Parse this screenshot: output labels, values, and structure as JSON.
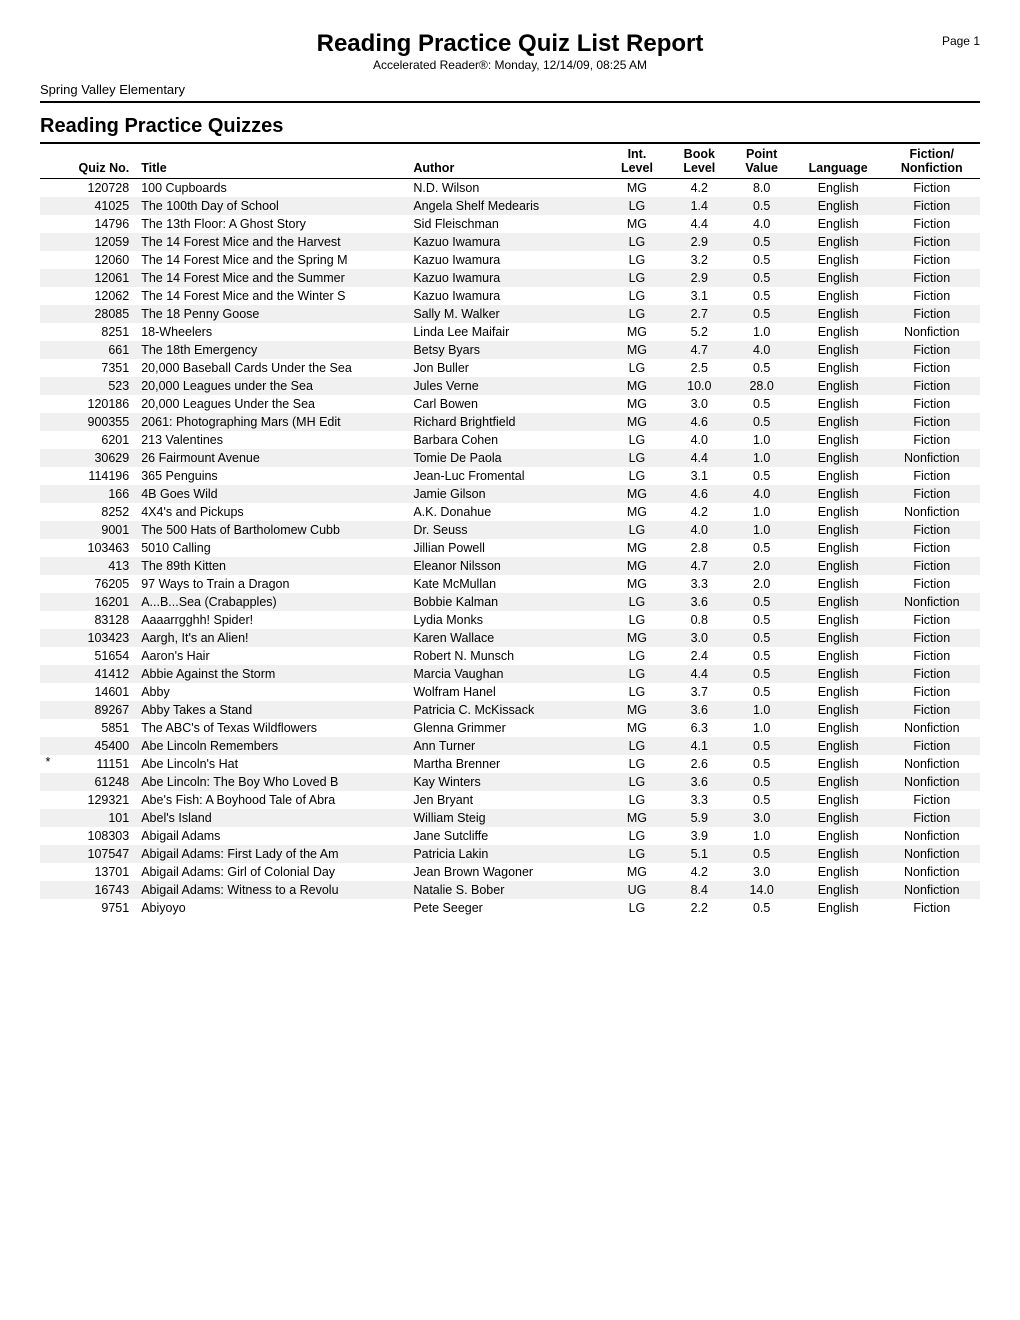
{
  "header": {
    "title": "Reading Practice Quiz List Report",
    "page_label": "Page 1",
    "subtitle": "Accelerated Reader®:  Monday, 12/14/09, 08:25 AM",
    "school": "Spring Valley Elementary"
  },
  "section_title": "Reading Practice Quizzes",
  "columns": {
    "quiz_no": "Quiz No.",
    "title": "Title",
    "author": "Author",
    "int_level": "Int.\nLevel",
    "book_level": "Book\nLevel",
    "point_value": "Point\nValue",
    "language": "Language",
    "fiction_nonfiction": "Fiction/\nNonfiction"
  },
  "rows": [
    {
      "star": "",
      "quiz_no": "120728",
      "title": "100 Cupboards",
      "author": "N.D. Wilson",
      "int_level": "MG",
      "book_level": "4.2",
      "point_value": "8.0",
      "language": "English",
      "fiction": "Fiction"
    },
    {
      "star": "",
      "quiz_no": "41025",
      "title": "The 100th Day of School",
      "author": "Angela Shelf Medearis",
      "int_level": "LG",
      "book_level": "1.4",
      "point_value": "0.5",
      "language": "English",
      "fiction": "Fiction"
    },
    {
      "star": "",
      "quiz_no": "14796",
      "title": "The 13th Floor: A Ghost Story",
      "author": "Sid Fleischman",
      "int_level": "MG",
      "book_level": "4.4",
      "point_value": "4.0",
      "language": "English",
      "fiction": "Fiction"
    },
    {
      "star": "",
      "quiz_no": "12059",
      "title": "The 14 Forest Mice and the Harvest",
      "author": "Kazuo Iwamura",
      "int_level": "LG",
      "book_level": "2.9",
      "point_value": "0.5",
      "language": "English",
      "fiction": "Fiction"
    },
    {
      "star": "",
      "quiz_no": "12060",
      "title": "The 14 Forest Mice and the Spring M",
      "author": "Kazuo Iwamura",
      "int_level": "LG",
      "book_level": "3.2",
      "point_value": "0.5",
      "language": "English",
      "fiction": "Fiction"
    },
    {
      "star": "",
      "quiz_no": "12061",
      "title": "The 14 Forest Mice and the Summer",
      "author": "Kazuo Iwamura",
      "int_level": "LG",
      "book_level": "2.9",
      "point_value": "0.5",
      "language": "English",
      "fiction": "Fiction"
    },
    {
      "star": "",
      "quiz_no": "12062",
      "title": "The 14 Forest Mice and the Winter S",
      "author": "Kazuo Iwamura",
      "int_level": "LG",
      "book_level": "3.1",
      "point_value": "0.5",
      "language": "English",
      "fiction": "Fiction"
    },
    {
      "star": "",
      "quiz_no": "28085",
      "title": "The 18 Penny Goose",
      "author": "Sally M. Walker",
      "int_level": "LG",
      "book_level": "2.7",
      "point_value": "0.5",
      "language": "English",
      "fiction": "Fiction"
    },
    {
      "star": "",
      "quiz_no": "8251",
      "title": "18-Wheelers",
      "author": "Linda Lee Maifair",
      "int_level": "MG",
      "book_level": "5.2",
      "point_value": "1.0",
      "language": "English",
      "fiction": "Nonfiction"
    },
    {
      "star": "",
      "quiz_no": "661",
      "title": "The 18th Emergency",
      "author": "Betsy Byars",
      "int_level": "MG",
      "book_level": "4.7",
      "point_value": "4.0",
      "language": "English",
      "fiction": "Fiction"
    },
    {
      "star": "",
      "quiz_no": "7351",
      "title": "20,000 Baseball Cards Under the Sea",
      "author": "Jon Buller",
      "int_level": "LG",
      "book_level": "2.5",
      "point_value": "0.5",
      "language": "English",
      "fiction": "Fiction"
    },
    {
      "star": "",
      "quiz_no": "523",
      "title": "20,000 Leagues under the Sea",
      "author": "Jules Verne",
      "int_level": "MG",
      "book_level": "10.0",
      "point_value": "28.0",
      "language": "English",
      "fiction": "Fiction"
    },
    {
      "star": "",
      "quiz_no": "120186",
      "title": "20,000 Leagues Under the Sea",
      "author": "Carl Bowen",
      "int_level": "MG",
      "book_level": "3.0",
      "point_value": "0.5",
      "language": "English",
      "fiction": "Fiction"
    },
    {
      "star": "",
      "quiz_no": "900355",
      "title": "2061: Photographing Mars (MH Edit",
      "author": "Richard Brightfield",
      "int_level": "MG",
      "book_level": "4.6",
      "point_value": "0.5",
      "language": "English",
      "fiction": "Fiction"
    },
    {
      "star": "",
      "quiz_no": "6201",
      "title": "213 Valentines",
      "author": "Barbara Cohen",
      "int_level": "LG",
      "book_level": "4.0",
      "point_value": "1.0",
      "language": "English",
      "fiction": "Fiction"
    },
    {
      "star": "",
      "quiz_no": "30629",
      "title": "26 Fairmount Avenue",
      "author": "Tomie De Paola",
      "int_level": "LG",
      "book_level": "4.4",
      "point_value": "1.0",
      "language": "English",
      "fiction": "Nonfiction"
    },
    {
      "star": "",
      "quiz_no": "114196",
      "title": "365 Penguins",
      "author": "Jean-Luc Fromental",
      "int_level": "LG",
      "book_level": "3.1",
      "point_value": "0.5",
      "language": "English",
      "fiction": "Fiction"
    },
    {
      "star": "",
      "quiz_no": "166",
      "title": "4B Goes Wild",
      "author": "Jamie Gilson",
      "int_level": "MG",
      "book_level": "4.6",
      "point_value": "4.0",
      "language": "English",
      "fiction": "Fiction"
    },
    {
      "star": "",
      "quiz_no": "8252",
      "title": "4X4's and Pickups",
      "author": "A.K. Donahue",
      "int_level": "MG",
      "book_level": "4.2",
      "point_value": "1.0",
      "language": "English",
      "fiction": "Nonfiction"
    },
    {
      "star": "",
      "quiz_no": "9001",
      "title": "The 500 Hats of Bartholomew Cubb",
      "author": "Dr. Seuss",
      "int_level": "LG",
      "book_level": "4.0",
      "point_value": "1.0",
      "language": "English",
      "fiction": "Fiction"
    },
    {
      "star": "",
      "quiz_no": "103463",
      "title": "5010 Calling",
      "author": "Jillian Powell",
      "int_level": "MG",
      "book_level": "2.8",
      "point_value": "0.5",
      "language": "English",
      "fiction": "Fiction"
    },
    {
      "star": "",
      "quiz_no": "413",
      "title": "The 89th Kitten",
      "author": "Eleanor Nilsson",
      "int_level": "MG",
      "book_level": "4.7",
      "point_value": "2.0",
      "language": "English",
      "fiction": "Fiction"
    },
    {
      "star": "",
      "quiz_no": "76205",
      "title": "97 Ways to Train a Dragon",
      "author": "Kate McMullan",
      "int_level": "MG",
      "book_level": "3.3",
      "point_value": "2.0",
      "language": "English",
      "fiction": "Fiction"
    },
    {
      "star": "",
      "quiz_no": "16201",
      "title": "A...B...Sea (Crabapples)",
      "author": "Bobbie Kalman",
      "int_level": "LG",
      "book_level": "3.6",
      "point_value": "0.5",
      "language": "English",
      "fiction": "Nonfiction"
    },
    {
      "star": "",
      "quiz_no": "83128",
      "title": "Aaaarrgghh! Spider!",
      "author": "Lydia Monks",
      "int_level": "LG",
      "book_level": "0.8",
      "point_value": "0.5",
      "language": "English",
      "fiction": "Fiction"
    },
    {
      "star": "",
      "quiz_no": "103423",
      "title": "Aargh, It's an Alien!",
      "author": "Karen Wallace",
      "int_level": "MG",
      "book_level": "3.0",
      "point_value": "0.5",
      "language": "English",
      "fiction": "Fiction"
    },
    {
      "star": "",
      "quiz_no": "51654",
      "title": "Aaron's Hair",
      "author": "Robert N. Munsch",
      "int_level": "LG",
      "book_level": "2.4",
      "point_value": "0.5",
      "language": "English",
      "fiction": "Fiction"
    },
    {
      "star": "",
      "quiz_no": "41412",
      "title": "Abbie Against the Storm",
      "author": "Marcia Vaughan",
      "int_level": "LG",
      "book_level": "4.4",
      "point_value": "0.5",
      "language": "English",
      "fiction": "Fiction"
    },
    {
      "star": "",
      "quiz_no": "14601",
      "title": "Abby",
      "author": "Wolfram Hanel",
      "int_level": "LG",
      "book_level": "3.7",
      "point_value": "0.5",
      "language": "English",
      "fiction": "Fiction"
    },
    {
      "star": "",
      "quiz_no": "89267",
      "title": "Abby Takes a Stand",
      "author": "Patricia C. McKissack",
      "int_level": "MG",
      "book_level": "3.6",
      "point_value": "1.0",
      "language": "English",
      "fiction": "Fiction"
    },
    {
      "star": "",
      "quiz_no": "5851",
      "title": "The ABC's of Texas Wildflowers",
      "author": "Glenna Grimmer",
      "int_level": "MG",
      "book_level": "6.3",
      "point_value": "1.0",
      "language": "English",
      "fiction": "Nonfiction"
    },
    {
      "star": "",
      "quiz_no": "45400",
      "title": "Abe Lincoln Remembers",
      "author": "Ann Turner",
      "int_level": "LG",
      "book_level": "4.1",
      "point_value": "0.5",
      "language": "English",
      "fiction": "Fiction"
    },
    {
      "star": "*",
      "quiz_no": "11151",
      "title": "Abe Lincoln's Hat",
      "author": "Martha Brenner",
      "int_level": "LG",
      "book_level": "2.6",
      "point_value": "0.5",
      "language": "English",
      "fiction": "Nonfiction"
    },
    {
      "star": "",
      "quiz_no": "61248",
      "title": "Abe Lincoln: The Boy Who Loved B",
      "author": "Kay Winters",
      "int_level": "LG",
      "book_level": "3.6",
      "point_value": "0.5",
      "language": "English",
      "fiction": "Nonfiction"
    },
    {
      "star": "",
      "quiz_no": "129321",
      "title": "Abe's Fish: A Boyhood Tale of Abra",
      "author": "Jen Bryant",
      "int_level": "LG",
      "book_level": "3.3",
      "point_value": "0.5",
      "language": "English",
      "fiction": "Fiction"
    },
    {
      "star": "",
      "quiz_no": "101",
      "title": "Abel's Island",
      "author": "William Steig",
      "int_level": "MG",
      "book_level": "5.9",
      "point_value": "3.0",
      "language": "English",
      "fiction": "Fiction"
    },
    {
      "star": "",
      "quiz_no": "108303",
      "title": "Abigail Adams",
      "author": "Jane Sutcliffe",
      "int_level": "LG",
      "book_level": "3.9",
      "point_value": "1.0",
      "language": "English",
      "fiction": "Nonfiction"
    },
    {
      "star": "",
      "quiz_no": "107547",
      "title": "Abigail Adams: First Lady of the Am",
      "author": "Patricia Lakin",
      "int_level": "LG",
      "book_level": "5.1",
      "point_value": "0.5",
      "language": "English",
      "fiction": "Nonfiction"
    },
    {
      "star": "",
      "quiz_no": "13701",
      "title": "Abigail Adams: Girl of Colonial Day",
      "author": "Jean Brown Wagoner",
      "int_level": "MG",
      "book_level": "4.2",
      "point_value": "3.0",
      "language": "English",
      "fiction": "Nonfiction"
    },
    {
      "star": "",
      "quiz_no": "16743",
      "title": "Abigail Adams: Witness to a Revolu",
      "author": "Natalie S. Bober",
      "int_level": "UG",
      "book_level": "8.4",
      "point_value": "14.0",
      "language": "English",
      "fiction": "Nonfiction"
    },
    {
      "star": "",
      "quiz_no": "9751",
      "title": "Abiyoyo",
      "author": "Pete Seeger",
      "int_level": "LG",
      "book_level": "2.2",
      "point_value": "0.5",
      "language": "English",
      "fiction": "Fiction"
    }
  ]
}
